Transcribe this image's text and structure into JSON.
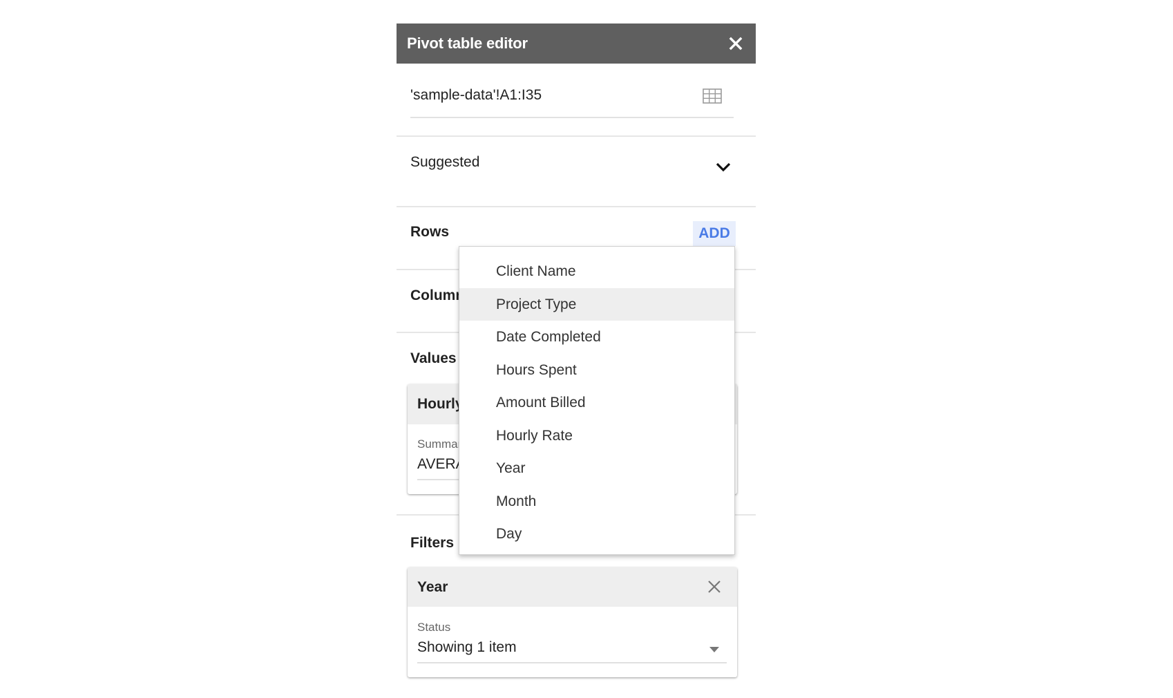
{
  "header": {
    "title": "Pivot table editor",
    "close_icon": "close-icon"
  },
  "range": {
    "value": "'sample-data'!A1:I35",
    "icon": "grid-select-icon"
  },
  "suggested": {
    "label": "Suggested",
    "icon": "chevron-down-icon"
  },
  "rows": {
    "label": "Rows",
    "add_label": "ADD"
  },
  "columns": {
    "label": "Columns"
  },
  "values": {
    "label": "Values",
    "card": {
      "title": "Hourly Rate",
      "sublabel": "Summarize by",
      "value": "AVERAGE"
    }
  },
  "filters": {
    "label": "Filters",
    "card": {
      "title": "Year",
      "sublabel": "Status",
      "value": "Showing 1 item",
      "close_icon": "close-icon",
      "dropdown_icon": "dropdown-arrow-icon"
    }
  },
  "dropdown": {
    "highlighted_index": 1,
    "items": [
      {
        "label": "Client Name"
      },
      {
        "label": "Project Type"
      },
      {
        "label": "Date Completed"
      },
      {
        "label": "Hours Spent"
      },
      {
        "label": "Amount Billed"
      },
      {
        "label": "Hourly Rate"
      },
      {
        "label": "Year"
      },
      {
        "label": "Month"
      },
      {
        "label": "Day"
      }
    ]
  },
  "colors": {
    "header_bg": "#5f5f5f",
    "accent": "#4a7be6",
    "accent_bg": "#e8eefc",
    "highlight_bg": "#eeeeee"
  }
}
